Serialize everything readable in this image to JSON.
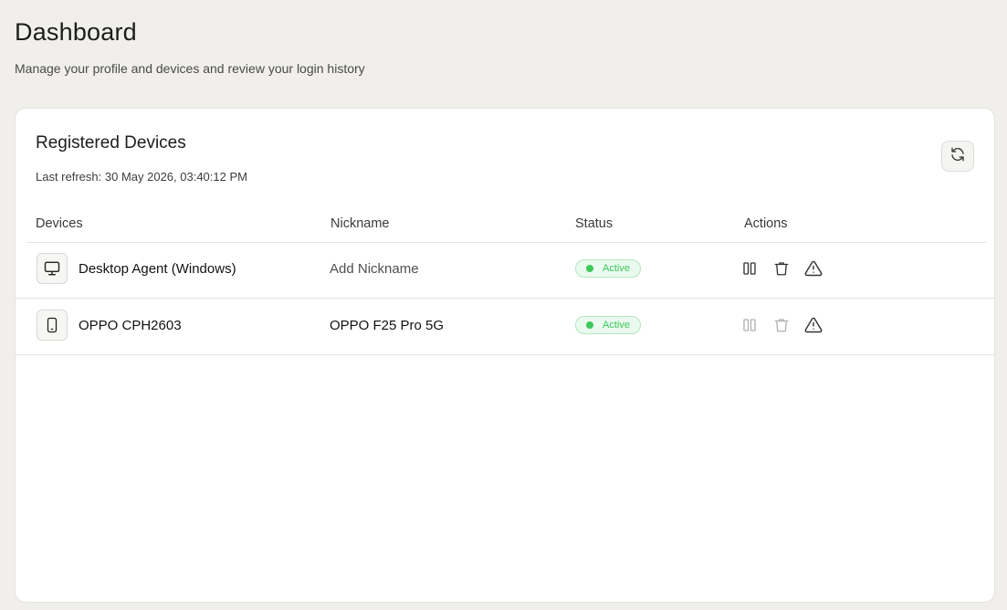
{
  "page": {
    "title": "Dashboard",
    "subtitle": "Manage your profile and devices and review your login history"
  },
  "devices_card": {
    "title": "Registered Devices",
    "last_refresh": "Last refresh: 30 May 2026, 03:40:12 PM",
    "refresh_icon": "refresh-icon",
    "columns": [
      "Devices",
      "Nickname",
      "Status",
      "Actions"
    ],
    "rows": [
      {
        "icon": "monitor-icon",
        "device": "Desktop Agent (Windows)",
        "nickname": "Add Nickname",
        "nickname_is_placeholder": true,
        "status": "Active",
        "actions_enabled": true
      },
      {
        "icon": "smartphone-icon",
        "device": "OPPO CPH2603",
        "nickname": "OPPO F25 Pro 5G",
        "nickname_is_placeholder": false,
        "status": "Active",
        "actions_enabled": false
      }
    ],
    "action_icons": [
      "pause-icon",
      "trash-icon",
      "alert-triangle-icon"
    ]
  },
  "colors": {
    "background": "#f0efeb",
    "card": "#ffffff",
    "active_green": "#3ec75b",
    "active_badge_bg": "#eafaee"
  }
}
